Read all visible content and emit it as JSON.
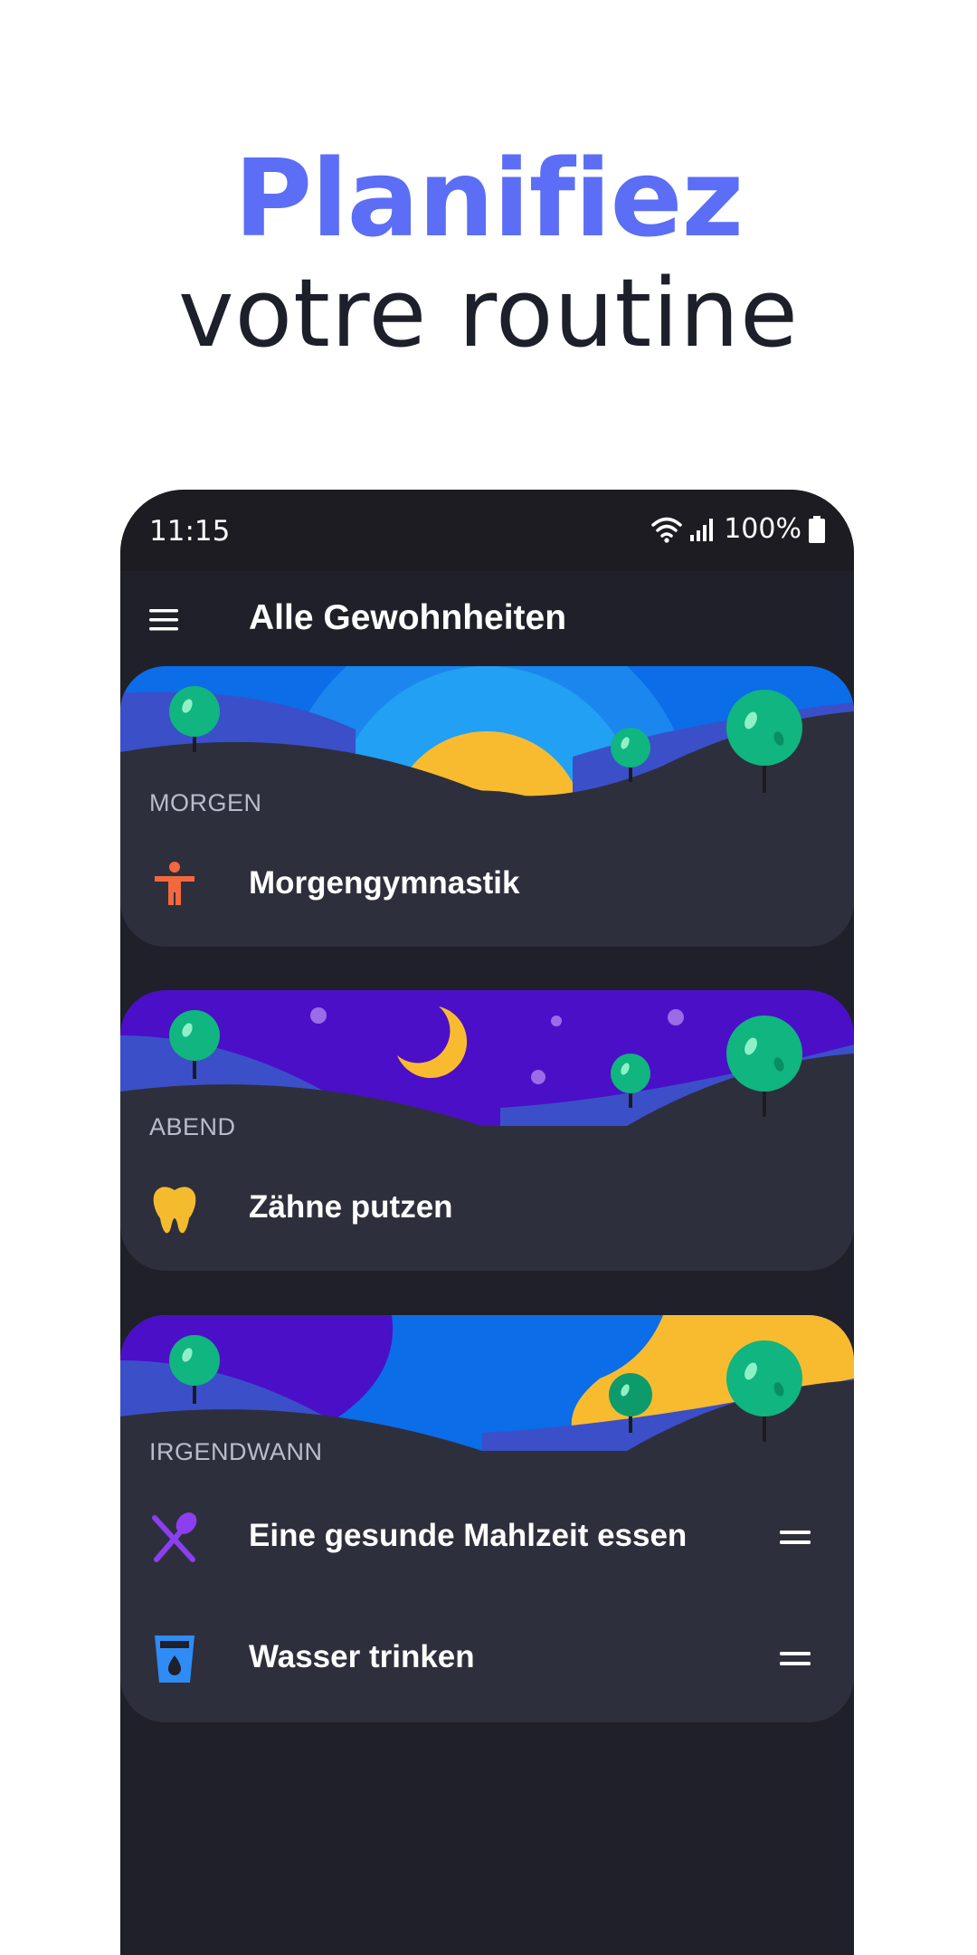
{
  "promo": {
    "headline_line1": "Planifiez",
    "headline_line2": "votre routine"
  },
  "statusbar": {
    "time": "11:15",
    "battery": "100%",
    "icons": [
      "wifi-icon",
      "signal-icon",
      "battery-icon"
    ]
  },
  "appbar": {
    "title": "Alle Gewohnheiten",
    "menu_icon": "hamburger-menu-icon"
  },
  "sections": [
    {
      "label": "MORGEN",
      "theme": "sunrise",
      "habits": [
        {
          "label": "Morgengymnastik",
          "icon": "person-exercise-icon",
          "icon_color": "#f2683f"
        }
      ]
    },
    {
      "label": "ABEND",
      "theme": "night",
      "habits": [
        {
          "label": "Zähne putzen",
          "icon": "tooth-icon",
          "icon_color": "#f5bb2e"
        }
      ]
    },
    {
      "label": "IRGENDWANN",
      "theme": "anytime",
      "habits": [
        {
          "label": "Eine gesunde Mahlzeit essen",
          "icon": "fork-spoon-icon",
          "icon_color": "#8b3ff0"
        },
        {
          "label": "Wasser trinken",
          "icon": "water-glass-icon",
          "icon_color": "#2f8cf5"
        }
      ]
    }
  ],
  "colors": {
    "accent": "#5b6ef5",
    "phone_bg": "#1f2029",
    "card_bg": "#2e2f3c",
    "tree_green": "#10b57f",
    "sun_yellow": "#f8bb2f"
  }
}
